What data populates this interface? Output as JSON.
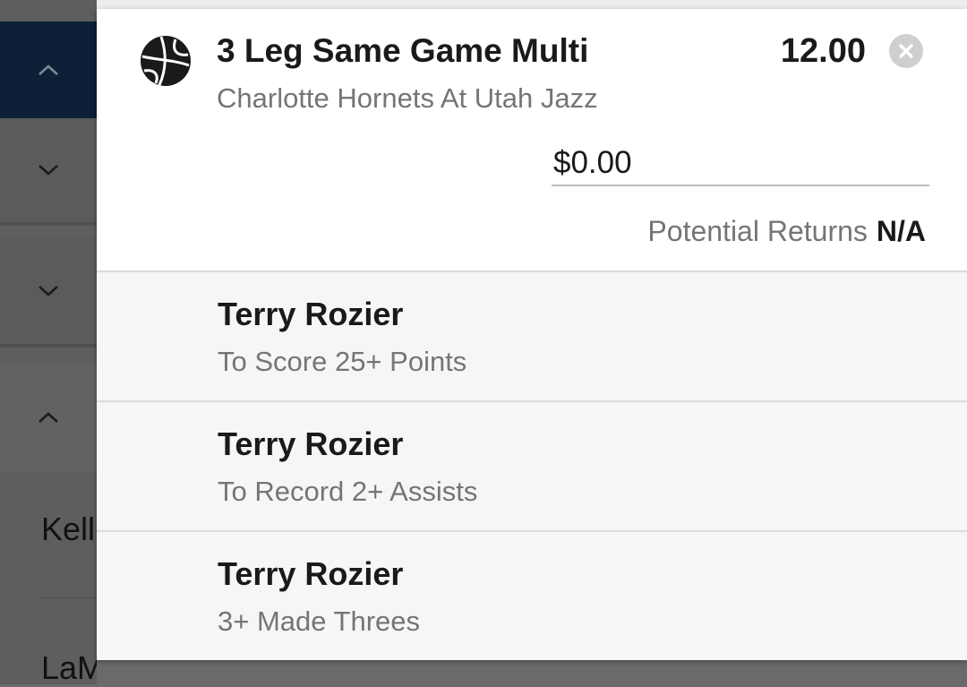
{
  "background": {
    "chevrons": [
      "chevron-up",
      "chevron-down",
      "chevron-down",
      "chevron-up"
    ],
    "names": [
      "Kell",
      "LaM"
    ]
  },
  "bet": {
    "sport_icon": "basketball-icon",
    "title": "3 Leg Same Game Multi",
    "event": "Charlotte Hornets At Utah Jazz",
    "odds": "12.00",
    "close_icon": "close-icon",
    "stake_value": "$0.00",
    "potential_returns_label": "Potential Returns",
    "potential_returns_value": "N/A"
  },
  "legs": [
    {
      "player": "Terry Rozier",
      "market": "To Score 25+ Points"
    },
    {
      "player": "Terry Rozier",
      "market": "To Record 2+ Assists"
    },
    {
      "player": "Terry Rozier",
      "market": "3+ Made Threes"
    }
  ],
  "colors": {
    "header_accent": "#0d2037",
    "text_primary": "#1a1a1a",
    "text_secondary": "#757575",
    "leg_background": "#f6f6f6"
  }
}
